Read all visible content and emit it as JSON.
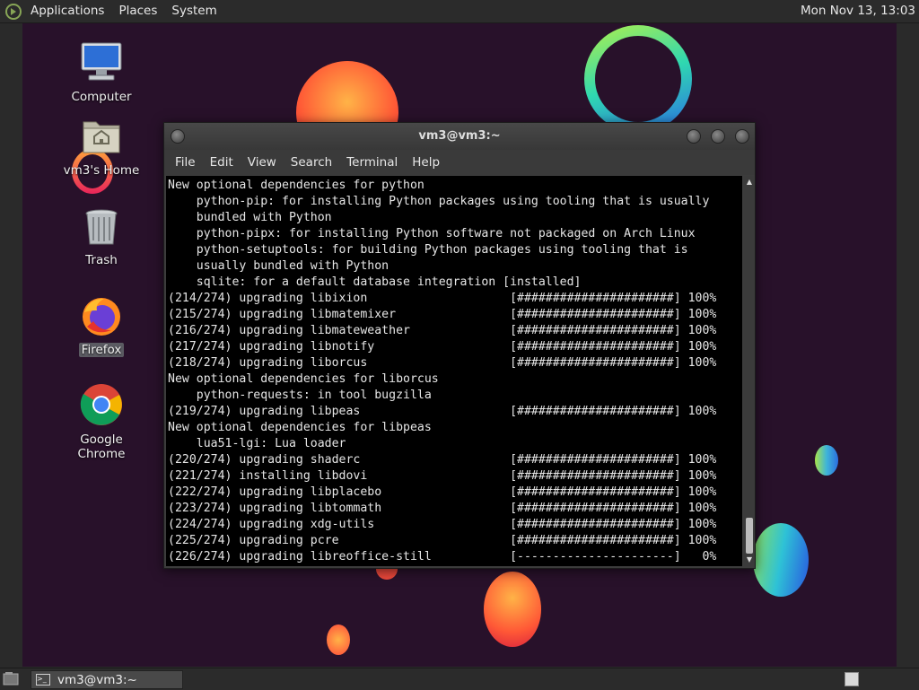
{
  "top_panel": {
    "menus": [
      "Applications",
      "Places",
      "System"
    ],
    "clock": "Mon Nov 13, 13:03"
  },
  "desktop_icons": [
    {
      "label": "Computer",
      "icon": "computer-icon"
    },
    {
      "label": "vm3's Home",
      "icon": "home-folder-icon"
    },
    {
      "label": "Trash",
      "icon": "trash-icon"
    },
    {
      "label": "Firefox",
      "icon": "firefox-icon"
    },
    {
      "label": "Google Chrome",
      "icon": "chrome-icon"
    }
  ],
  "terminal": {
    "title": "vm3@vm3:~",
    "menu": [
      "File",
      "Edit",
      "View",
      "Search",
      "Terminal",
      "Help"
    ],
    "lines": [
      "New optional dependencies for python",
      "    python-pip: for installing Python packages using tooling that is usually",
      "    bundled with Python",
      "    python-pipx: for installing Python software not packaged on Arch Linux",
      "    python-setuptools: for building Python packages using tooling that is",
      "    usually bundled with Python",
      "    sqlite: for a default database integration [installed]",
      "(214/274) upgrading libixion                    [######################] 100%",
      "(215/274) upgrading libmatemixer                [######################] 100%",
      "(216/274) upgrading libmateweather              [######################] 100%",
      "(217/274) upgrading libnotify                   [######################] 100%",
      "(218/274) upgrading liborcus                    [######################] 100%",
      "New optional dependencies for liborcus",
      "    python-requests: in tool bugzilla",
      "(219/274) upgrading libpeas                     [######################] 100%",
      "New optional dependencies for libpeas",
      "    lua51-lgi: Lua loader",
      "(220/274) upgrading shaderc                     [######################] 100%",
      "(221/274) installing libdovi                    [######################] 100%",
      "(222/274) upgrading libplacebo                  [######################] 100%",
      "(223/274) upgrading libtommath                  [######################] 100%",
      "(224/274) upgrading xdg-utils                   [######################] 100%",
      "(225/274) upgrading pcre                        [######################] 100%",
      "(226/274) upgrading libreoffice-still           [----------------------]   0%"
    ]
  },
  "taskbar": {
    "window_button": "vm3@vm3:~"
  }
}
